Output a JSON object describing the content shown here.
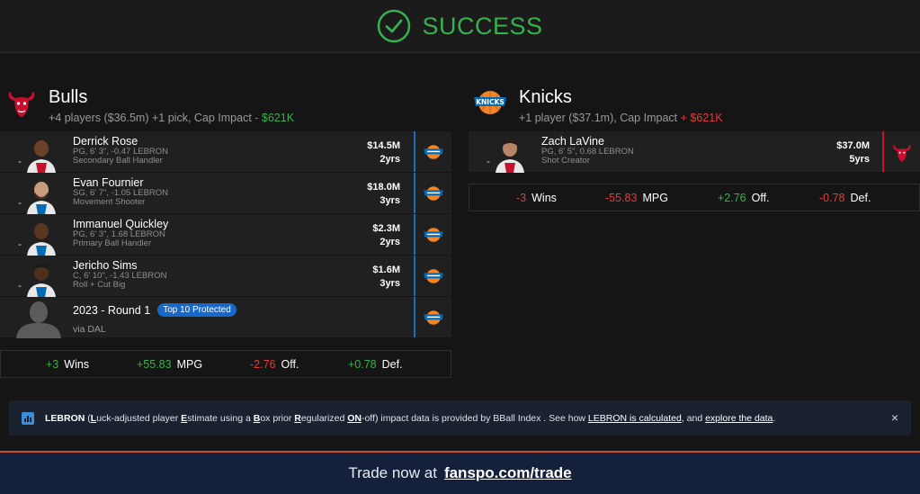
{
  "header": {
    "status": "SUCCESS",
    "icon": "check-circle-icon",
    "color": "#36b14d"
  },
  "bulls": {
    "name": "Bulls",
    "summary_prefix": "+4 players ($36.5m) +1 pick, Cap Impact",
    "cap_impact": "- $621K",
    "players": [
      {
        "name": "Derrick Rose",
        "line1": "PG, 6' 3\", -0.47 LEBRON",
        "line2": "Secondary Ball Handler",
        "salary": "$14.5M",
        "years": "2yrs",
        "dash": "-"
      },
      {
        "name": "Evan Fournier",
        "line1": "SG, 6' 7\", -1.05 LEBRON",
        "line2": "Movement Shooter",
        "salary": "$18.0M",
        "years": "3yrs",
        "dash": "-"
      },
      {
        "name": "Immanuel Quickley",
        "line1": "PG, 6' 3\", 1.68 LEBRON",
        "line2": "Primary Ball Handler",
        "salary": "$2.3M",
        "years": "2yrs",
        "dash": "-"
      },
      {
        "name": "Jericho Sims",
        "line1": "C, 6' 10\", -1.43 LEBRON",
        "line2": "Roll + Cut Big",
        "salary": "$1.6M",
        "years": "3yrs",
        "dash": "-"
      }
    ],
    "pick": {
      "title": "2023 - Round 1",
      "badge": "Top 10 Protected",
      "via": "via DAL"
    },
    "stats": [
      {
        "value": "+3",
        "label": "Wins",
        "sign": "pos"
      },
      {
        "value": "+55.83",
        "label": "MPG",
        "sign": "pos"
      },
      {
        "value": "-2.76",
        "label": "Off.",
        "sign": "neg"
      },
      {
        "value": "+0.78",
        "label": "Def.",
        "sign": "pos"
      }
    ]
  },
  "knicks": {
    "name": "Knicks",
    "summary_prefix": "+1 player ($37.1m), Cap Impact",
    "cap_impact": "+ $621K",
    "players": [
      {
        "name": "Zach LaVine",
        "line1": "PG, 6' 5\", 0.68 LEBRON",
        "line2": "Shot Creator",
        "salary": "$37.0M",
        "years": "5yrs",
        "dash": "-"
      }
    ],
    "stats": [
      {
        "value": "-3",
        "label": "Wins",
        "sign": "neg"
      },
      {
        "value": "-55.83",
        "label": "MPG",
        "sign": "neg"
      },
      {
        "value": "+2.76",
        "label": "Off.",
        "sign": "pos"
      },
      {
        "value": "-0.78",
        "label": "Def.",
        "sign": "neg"
      }
    ]
  },
  "info": {
    "lebron": "LEBRON",
    "p1": " (",
    "L": "L",
    "t1": "uck-adjusted player ",
    "E": "E",
    "t2": "stimate using a ",
    "B": "B",
    "t3": "ox prior ",
    "R": "R",
    "t4": "egularized ",
    "ON": "ON",
    "t5": "-off) impact data is provided by BBall Index . See how ",
    "link1": "LEBRON is calculated",
    "t6": ", and ",
    "link2": "explore the data",
    "t7": ".",
    "close": "×"
  },
  "footer": {
    "prefix": "Trade now at",
    "link": "fanspo.com/trade"
  },
  "colors": {
    "positive": "#36b14d",
    "negative": "#e53b3b",
    "accent_blue": "#1768c9",
    "footer_bg": "#15213c",
    "footer_border": "#c6531f"
  }
}
